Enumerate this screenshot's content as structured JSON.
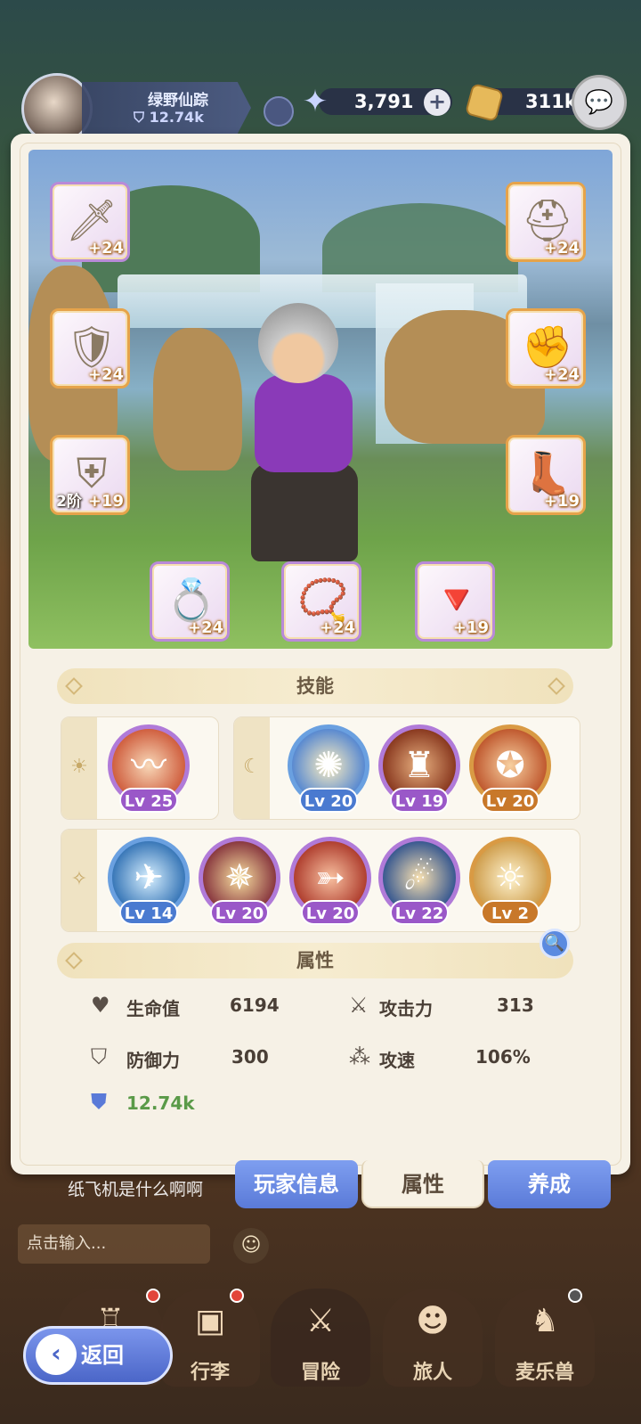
{
  "player": {
    "name": "绿野仙踪",
    "power": "12.74k"
  },
  "resources": {
    "stars": "3,791",
    "coins": "311k",
    "plus_icon": "plus-icon",
    "star_icon": "star-icon",
    "coin_icon": "coin-icon"
  },
  "equipment": {
    "left": [
      {
        "name": "weapon",
        "level": "+24",
        "icon": "sword-icon"
      },
      {
        "name": "armor",
        "level": "+24",
        "icon": "armor-icon"
      },
      {
        "name": "pants",
        "level": "+19",
        "tier": "2阶",
        "icon": "pants-icon"
      }
    ],
    "right": [
      {
        "name": "helmet",
        "level": "+24",
        "icon": "helmet-icon"
      },
      {
        "name": "gloves",
        "level": "+24",
        "icon": "gloves-icon"
      },
      {
        "name": "boots",
        "level": "+19",
        "icon": "boots-icon"
      }
    ],
    "bottom": [
      {
        "name": "ring",
        "level": "+24",
        "icon": "ring-icon"
      },
      {
        "name": "necklace",
        "level": "+24",
        "icon": "necklace-icon"
      },
      {
        "name": "amulet",
        "level": "+19",
        "icon": "amulet-icon"
      }
    ]
  },
  "skills": {
    "title": "技能",
    "day": [
      {
        "level": "Lv 25"
      }
    ],
    "night": [
      {
        "level": "Lv 20"
      },
      {
        "level": "Lv 19"
      },
      {
        "level": "Lv 20"
      }
    ],
    "passive": [
      {
        "level": "Lv 14"
      },
      {
        "level": "Lv 20"
      },
      {
        "level": "Lv 20"
      },
      {
        "level": "Lv 22"
      },
      {
        "level": "Lv 2"
      }
    ]
  },
  "attributes": {
    "title": "属性",
    "hp_label": "生命值",
    "hp": "6194",
    "atk_label": "攻击力",
    "atk": "313",
    "def_label": "防御力",
    "def": "300",
    "spd_label": "攻速",
    "spd": "106%",
    "power": "12.74k"
  },
  "tabs": [
    "玩家信息",
    "属性",
    "养成"
  ],
  "chat": {
    "last_message": "纸飞机是什么啊啊",
    "input_placeholder": "点击输入..."
  },
  "nav": [
    "行李",
    "冒险",
    "旅人",
    "麦乐兽"
  ],
  "back_label": "返回",
  "colors": {
    "accent_blue": "#5a7ad8",
    "panel_bg": "#f6f1e6",
    "level_orange": "#e6a34a",
    "power_green": "#5a9a48"
  }
}
